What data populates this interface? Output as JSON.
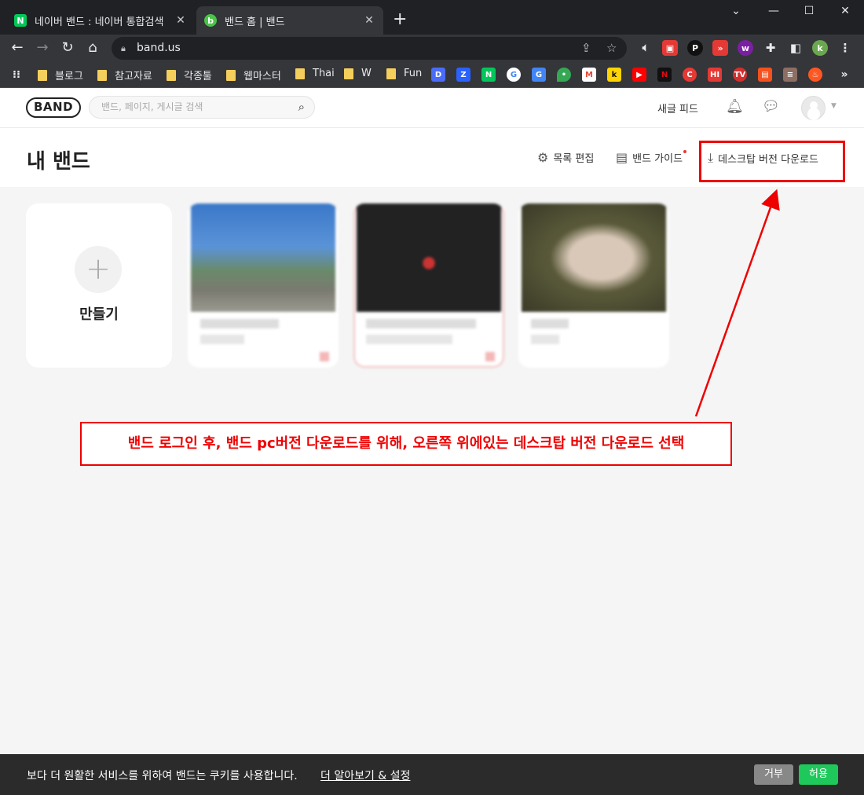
{
  "browser": {
    "tabs": [
      {
        "title": "네이버 밴드 : 네이버 통합검색",
        "favicon": "N",
        "favicon_color": "#03c75a"
      },
      {
        "title": "밴드 홈 | 밴드",
        "favicon": "b",
        "favicon_color": "#4cc34a"
      }
    ],
    "new_tab": "+",
    "url": "band.us",
    "bookmarks": [
      "블로그",
      "참고자료",
      "각종툴",
      "웹마스터",
      "Thai",
      "W",
      "Fun"
    ],
    "profile_initial": "k"
  },
  "header": {
    "logo": "BAND",
    "search_placeholder": "밴드, 페이지, 게시글 검색",
    "new_feed": "새글 피드"
  },
  "page": {
    "title": "내 밴드",
    "actions": {
      "edit_list": "목록 편집",
      "band_guide": "밴드 가이드",
      "desktop_download": "데스크탑 버전 다운로드"
    },
    "create_label": "만들기",
    "plus_glyph": "+"
  },
  "annotation": {
    "text": "밴드 로그인 후, 밴드 pc버전 다운로드를 위해, 오른쪽 위에있는 데스크탑 버전 다운로드 선택",
    "color": "#ee0000"
  },
  "cookie_bar": {
    "message": "보다 더 원활한 서비스를 위하여 밴드는 쿠키를 사용합니다.",
    "link": "더 알아보기 & 설정",
    "deny": "거부",
    "allow": "허용"
  }
}
